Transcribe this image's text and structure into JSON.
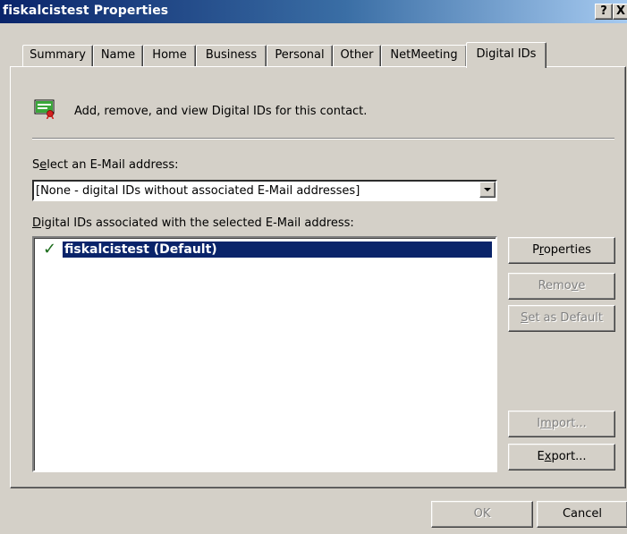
{
  "window": {
    "title": "fiskalcistest Properties",
    "help_glyph": "?",
    "close_glyph": "X"
  },
  "tabs": [
    {
      "label": "Summary"
    },
    {
      "label": "Name"
    },
    {
      "label": "Home"
    },
    {
      "label": "Business"
    },
    {
      "label": "Personal"
    },
    {
      "label": "Other"
    },
    {
      "label": "NetMeeting"
    },
    {
      "label": "Digital IDs",
      "active": true
    }
  ],
  "header": {
    "icon": "certificate-icon",
    "description": "Add, remove, and view Digital IDs for this contact."
  },
  "email": {
    "label_pre": "S",
    "label_u": "e",
    "label_post": "lect an E-Mail address:",
    "selected_value": "[None - digital IDs without associated E-Mail addresses]"
  },
  "ids": {
    "label_u": "D",
    "label_post": "igital IDs associated with the selected E-Mail address:",
    "items": [
      {
        "name": "fiskalcistest  (Default)",
        "checked": true,
        "selected": true
      }
    ]
  },
  "buttons": {
    "properties": {
      "pre": "P",
      "u": "r",
      "post": "operties",
      "enabled": true
    },
    "remove": {
      "pre": "Remo",
      "u": "v",
      "post": "e",
      "enabled": false
    },
    "set_default": {
      "pre": "",
      "u": "S",
      "post": "et as Default",
      "enabled": false
    },
    "import": {
      "pre": "I",
      "u": "m",
      "post": "port...",
      "enabled": false
    },
    "export": {
      "pre": "E",
      "u": "x",
      "post": "port...",
      "enabled": true
    },
    "ok": {
      "label": "OK",
      "enabled": false
    },
    "cancel": {
      "label": "Cancel",
      "enabled": true
    }
  },
  "colors": {
    "titlebar_start": "#0a246a",
    "titlebar_end": "#a6caf0",
    "face": "#d4d0c8",
    "selection": "#0a246a",
    "check": "#1a6b1a"
  }
}
